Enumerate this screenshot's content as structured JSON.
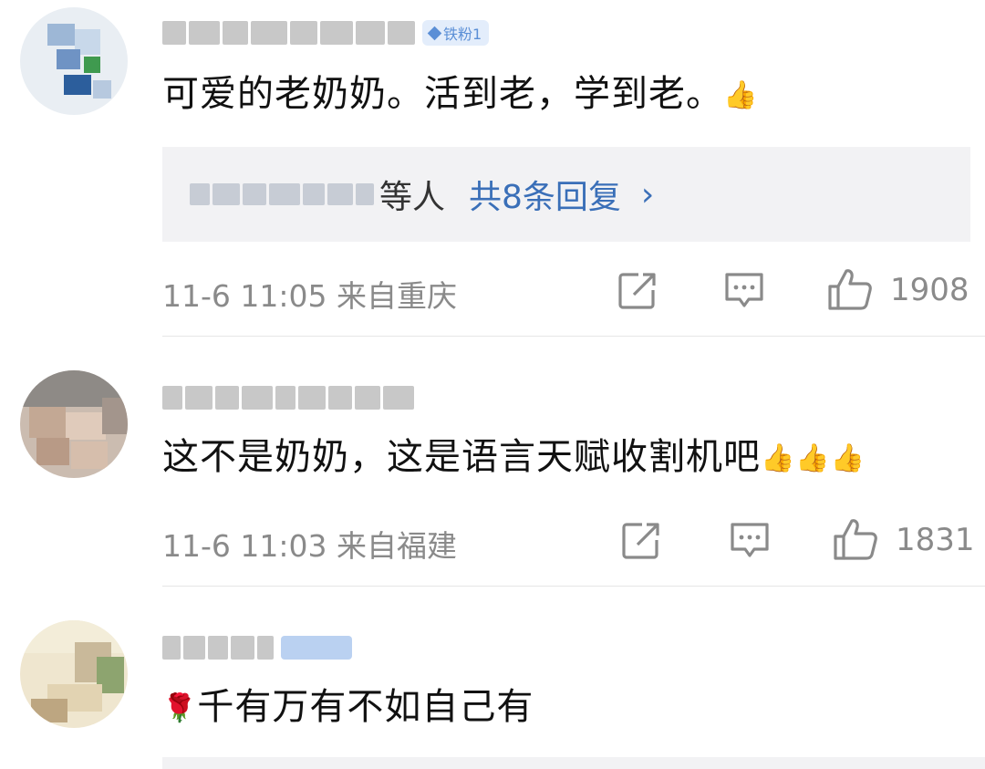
{
  "comments": [
    {
      "badge": "铁粉1",
      "text": "可爱的老奶奶。活到老，学到老。",
      "emoji": "👍",
      "reply_who": "等人",
      "reply_count": "共8条回复",
      "reply_chevron": "›",
      "meta": "11-6 11:05 来自重庆",
      "likes": "1908"
    },
    {
      "text": "这不是奶奶，这是语言天赋收割机吧",
      "emoji": "👍👍👍",
      "meta": "11-6 11:03 来自福建",
      "likes": "1831"
    },
    {
      "emoji_prefix": "🌹",
      "text": "千有万有不如自己有"
    }
  ],
  "icons": {
    "share": "share-icon",
    "comment": "comment-icon",
    "like": "thumbs-up-icon"
  },
  "colors": {
    "link_blue": "#3a6fb8",
    "meta_gray": "#8a8a8a",
    "reply_bg": "#f2f2f4"
  }
}
